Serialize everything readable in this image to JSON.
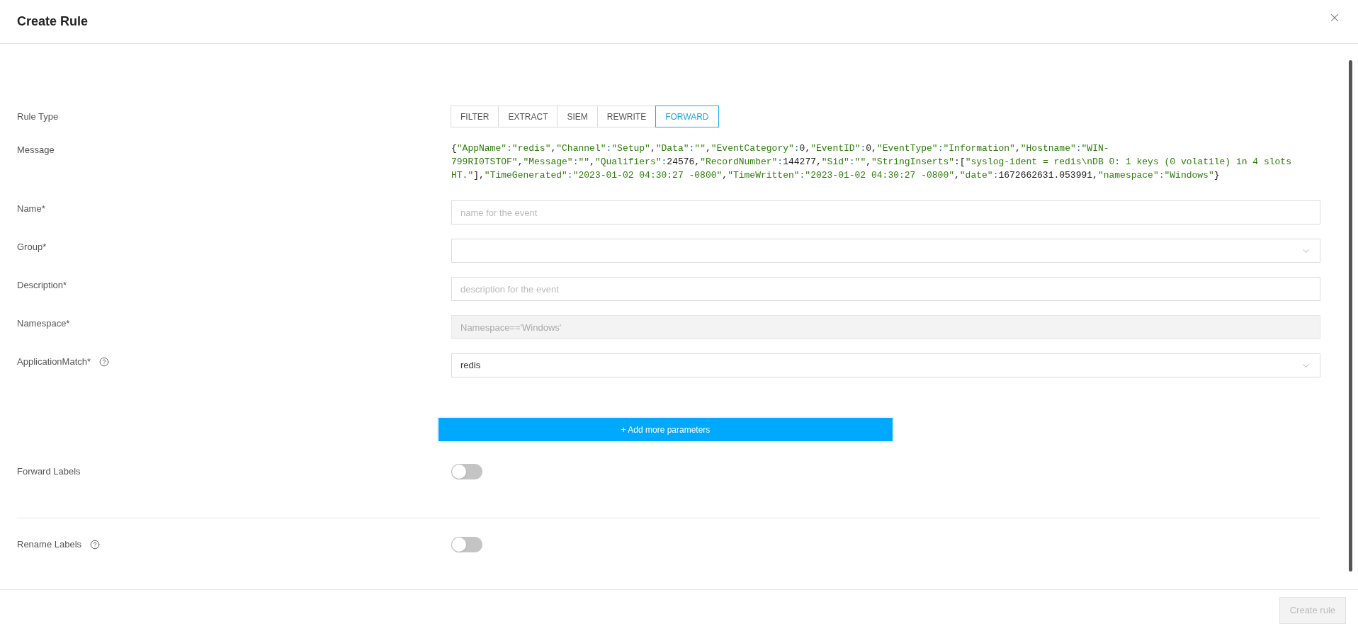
{
  "dialog": {
    "title": "Create Rule"
  },
  "rule_type": {
    "label": "Rule Type",
    "tabs": [
      {
        "label": "FILTER",
        "selected": false
      },
      {
        "label": "EXTRACT",
        "selected": false
      },
      {
        "label": "SIEM",
        "selected": false
      },
      {
        "label": "REWRITE",
        "selected": false
      },
      {
        "label": "FORWARD",
        "selected": true
      }
    ]
  },
  "message": {
    "label": "Message",
    "lines": [
      [
        {
          "kind": "plain",
          "text": "{"
        },
        {
          "kind": "str",
          "text": "\"AppName\""
        },
        {
          "kind": "colon",
          "text": ":"
        },
        {
          "kind": "str",
          "text": "\"redis\""
        },
        {
          "kind": "plain",
          "text": ","
        },
        {
          "kind": "str",
          "text": "\"Channel\""
        },
        {
          "kind": "colon",
          "text": ":"
        },
        {
          "kind": "str",
          "text": "\"Setup\""
        },
        {
          "kind": "plain",
          "text": ","
        },
        {
          "kind": "str",
          "text": "\"Data\""
        },
        {
          "kind": "colon",
          "text": ":"
        },
        {
          "kind": "str",
          "text": "\"\""
        },
        {
          "kind": "plain",
          "text": ","
        },
        {
          "kind": "str",
          "text": "\"EventCategory\""
        },
        {
          "kind": "colon",
          "text": ":"
        },
        {
          "kind": "plain",
          "text": "0,"
        },
        {
          "kind": "str",
          "text": "\"EventID\""
        },
        {
          "kind": "colon",
          "text": ":"
        },
        {
          "kind": "plain",
          "text": "0,"
        },
        {
          "kind": "str",
          "text": "\"EventType\""
        },
        {
          "kind": "colon",
          "text": ":"
        },
        {
          "kind": "str",
          "text": "\"Information\""
        },
        {
          "kind": "plain",
          "text": ","
        },
        {
          "kind": "str",
          "text": "\"Hostname\""
        },
        {
          "kind": "colon",
          "text": ":"
        },
        {
          "kind": "str",
          "text": "\"WIN-"
        }
      ],
      [
        {
          "kind": "str",
          "text": "799RI0TSTOF\""
        },
        {
          "kind": "plain",
          "text": ","
        },
        {
          "kind": "str",
          "text": "\"Message\""
        },
        {
          "kind": "colon",
          "text": ":"
        },
        {
          "kind": "str",
          "text": "\"\""
        },
        {
          "kind": "plain",
          "text": ","
        },
        {
          "kind": "str",
          "text": "\"Qualifiers\""
        },
        {
          "kind": "colon",
          "text": ":"
        },
        {
          "kind": "plain",
          "text": "24576,"
        },
        {
          "kind": "str",
          "text": "\"RecordNumber\""
        },
        {
          "kind": "colon",
          "text": ":"
        },
        {
          "kind": "plain",
          "text": "144277,"
        },
        {
          "kind": "str",
          "text": "\"Sid\""
        },
        {
          "kind": "colon",
          "text": ":"
        },
        {
          "kind": "str",
          "text": "\"\""
        },
        {
          "kind": "plain",
          "text": ","
        },
        {
          "kind": "str",
          "text": "\"StringInserts\""
        },
        {
          "kind": "plain",
          "text": ":["
        },
        {
          "kind": "str",
          "text": "\"syslog-ident = redis\\nDB 0: 1 keys (0 volatile) in 4 slots"
        }
      ],
      [
        {
          "kind": "str",
          "text": "HT.\""
        },
        {
          "kind": "plain",
          "text": "],"
        },
        {
          "kind": "str",
          "text": "\"TimeGenerated\""
        },
        {
          "kind": "colon",
          "text": ":"
        },
        {
          "kind": "str",
          "text": "\"2023-01-02 04:30:27 -0800\""
        },
        {
          "kind": "plain",
          "text": ","
        },
        {
          "kind": "str",
          "text": "\"TimeWritten\""
        },
        {
          "kind": "colon",
          "text": ":"
        },
        {
          "kind": "str",
          "text": "\"2023-01-02 04:30:27 -0800\""
        },
        {
          "kind": "plain",
          "text": ","
        },
        {
          "kind": "str",
          "text": "\"date\""
        },
        {
          "kind": "colon",
          "text": ":"
        },
        {
          "kind": "plain",
          "text": "1672662631.053991,"
        },
        {
          "kind": "str",
          "text": "\"namespace\""
        },
        {
          "kind": "colon",
          "text": ":"
        },
        {
          "kind": "str",
          "text": "\"Windows\""
        },
        {
          "kind": "plain",
          "text": "}"
        }
      ]
    ]
  },
  "fields": [
    {
      "kind": "input",
      "label": "Name*",
      "placeholder": "name for the event",
      "disabled": false,
      "help": false
    },
    {
      "kind": "select",
      "label": "Group*",
      "disabled": false,
      "help": false
    },
    {
      "kind": "input",
      "label": "Description*",
      "placeholder": "description for the event",
      "disabled": false,
      "help": false
    },
    {
      "kind": "input",
      "label": "Namespace*",
      "value": "Namespace=='Windows'",
      "disabled": true,
      "help": false
    },
    {
      "kind": "select",
      "label": "ApplicationMatch*",
      "value": "redis",
      "disabled": false,
      "help": true
    }
  ],
  "add_button": "+ Add more parameters",
  "toggles": [
    {
      "label": "Forward Labels",
      "on": false,
      "help": false
    },
    {
      "label": "Rename Labels",
      "on": false,
      "help": true
    }
  ],
  "footer": {
    "button": "Create rule",
    "disabled": true
  }
}
